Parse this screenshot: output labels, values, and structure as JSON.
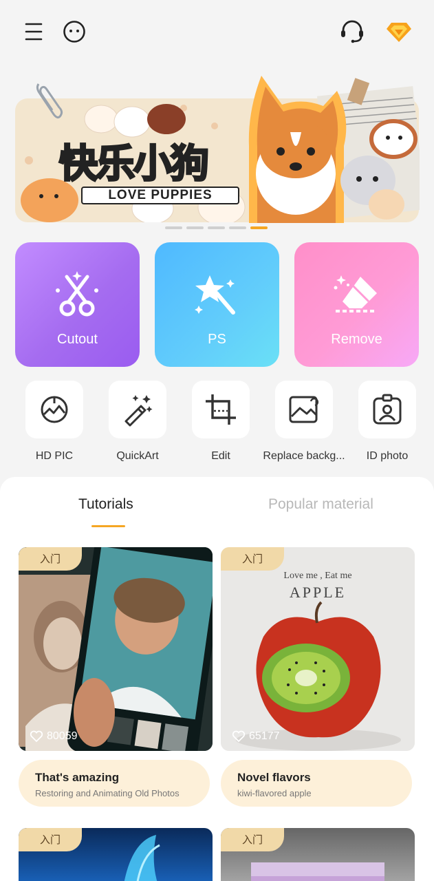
{
  "topbar": {
    "menu_icon": "menu-icon",
    "face_icon": "emoji-face-icon",
    "support_icon": "headset-icon",
    "vip_icon": "diamond-icon"
  },
  "banner": {
    "title_cn": "快乐小狗",
    "title_en": "LOVE PUPPIES",
    "pages": 5,
    "active_page": 5
  },
  "main_tools": [
    {
      "label": "Cutout",
      "icon": "scissors-icon",
      "color": "#a56cf0"
    },
    {
      "label": "PS",
      "icon": "magic-wand-icon",
      "color": "#55c4fd"
    },
    {
      "label": "Remove",
      "icon": "eraser-icon",
      "color": "#ff95d0"
    }
  ],
  "tools": [
    {
      "label": "HD PIC",
      "icon": "hd-pic-icon"
    },
    {
      "label": "QuickArt",
      "icon": "magic-sparkle-icon"
    },
    {
      "label": "Edit",
      "icon": "crop-icon"
    },
    {
      "label": "Replace backg...",
      "icon": "image-replace-icon"
    },
    {
      "label": "ID photo",
      "icon": "id-photo-icon"
    }
  ],
  "tabs": [
    {
      "label": "Tutorials",
      "active": true
    },
    {
      "label": "Popular material",
      "active": false
    }
  ],
  "cards": [
    {
      "badge": "入门",
      "likes": "80059",
      "title": "That's amazing",
      "subtitle": "Restoring and Animating Old Photos"
    },
    {
      "badge": "入门",
      "likes": "65177",
      "title": "Novel flavors",
      "subtitle": "kiwi-flavored apple",
      "image_text_top": "Love me , Eat me",
      "image_text_main": "APPLE"
    }
  ],
  "more_cards": [
    {
      "badge": "入门"
    },
    {
      "badge": "入门"
    }
  ]
}
